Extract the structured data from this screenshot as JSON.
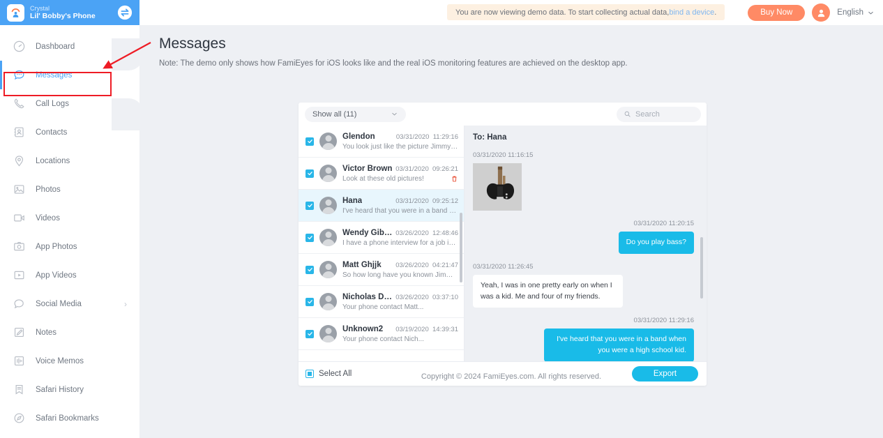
{
  "sidebar": {
    "account": {
      "name": "Crystal",
      "device": "Lil' Bobby's Phone"
    },
    "logo_icon": "famieyes-logo-icon",
    "swap_icon": "swap-device-icon",
    "items": [
      {
        "label": "Dashboard",
        "icon": "dashboard-icon",
        "active": false,
        "chevron": false
      },
      {
        "label": "Messages",
        "icon": "messages-icon",
        "active": true,
        "chevron": false
      },
      {
        "label": "Call Logs",
        "icon": "phone-icon",
        "active": false,
        "chevron": false
      },
      {
        "label": "Contacts",
        "icon": "contacts-icon",
        "active": false,
        "chevron": false
      },
      {
        "label": "Locations",
        "icon": "location-pin-icon",
        "active": false,
        "chevron": false
      },
      {
        "label": "Photos",
        "icon": "photo-icon",
        "active": false,
        "chevron": false
      },
      {
        "label": "Videos",
        "icon": "video-icon",
        "active": false,
        "chevron": false
      },
      {
        "label": "App Photos",
        "icon": "camera-icon",
        "active": false,
        "chevron": false
      },
      {
        "label": "App Videos",
        "icon": "play-box-icon",
        "active": false,
        "chevron": false
      },
      {
        "label": "Social Media",
        "icon": "chat-bubble-icon",
        "active": false,
        "chevron": true
      },
      {
        "label": "Notes",
        "icon": "note-pencil-icon",
        "active": false,
        "chevron": false
      },
      {
        "label": "Voice Memos",
        "icon": "waveform-icon",
        "active": false,
        "chevron": false
      },
      {
        "label": "Safari History",
        "icon": "bookmark-list-icon",
        "active": false,
        "chevron": false
      },
      {
        "label": "Safari Bookmarks",
        "icon": "safari-compass-icon",
        "active": false,
        "chevron": false
      }
    ]
  },
  "topbar": {
    "banner_text": "You are now viewing demo data. To start collecting actual data, ",
    "banner_link": "bind a device",
    "banner_tail": ".",
    "buy_now": "Buy Now",
    "avatar_icon": "user-avatar-icon",
    "language": "English",
    "language_chevron_icon": "chevron-down-icon"
  },
  "main": {
    "title": "Messages",
    "note": "Note: The demo only shows how FamiEyes for iOS looks like and the real iOS monitoring features are achieved on the desktop app.",
    "copyright": "Copyright © 2024 FamiEyes.com. All rights reserved."
  },
  "toolbar": {
    "filter_label": "Show all (11)",
    "filter_chevron_icon": "chevron-down-icon",
    "search_placeholder": "Search",
    "search_value": "",
    "search_icon": "search-icon"
  },
  "conversations": [
    {
      "name": "Glendon",
      "date": "03/31/2020",
      "time": "11:29:16",
      "preview": "You look just like the picture Jimmy sh...",
      "checked": true,
      "selected": false,
      "delete": false
    },
    {
      "name": "Victor Brown",
      "date": "03/31/2020",
      "time": "09:26:21",
      "preview": "Look at these old pictures!",
      "checked": true,
      "selected": false,
      "delete": true
    },
    {
      "name": "Hana",
      "date": "03/31/2020",
      "time": "09:25:12",
      "preview": "I've heard that you were in a band whe...",
      "checked": true,
      "selected": true,
      "delete": false
    },
    {
      "name": "Wendy Gibson",
      "date": "03/26/2020",
      "time": "12:48:46",
      "preview": "I have a phone interview for a job in an...",
      "checked": true,
      "selected": false,
      "delete": false
    },
    {
      "name": "Matt Ghjjk",
      "date": "03/26/2020",
      "time": "04:21:47",
      "preview": "So how long have you known Jimmy...",
      "checked": true,
      "selected": false,
      "delete": false
    },
    {
      "name": "Nicholas Dell...",
      "date": "03/26/2020",
      "time": "03:37:10",
      "preview": "Your phone contact Matt...",
      "checked": true,
      "selected": false,
      "delete": false
    },
    {
      "name": "Unknown2",
      "date": "03/19/2020",
      "time": "14:39:31",
      "preview": "Your phone contact Nich...",
      "checked": true,
      "selected": false,
      "delete": false
    }
  ],
  "thread": {
    "title": "To: Hana",
    "messages": [
      {
        "timestamp": "03/31/2020  11:16:15",
        "side": "in",
        "type": "image",
        "text": "",
        "image_icon": "bass-guitar-photo"
      },
      {
        "timestamp": "03/31/2020  11:20:15",
        "side": "out",
        "type": "text",
        "text": "Do you play bass?"
      },
      {
        "timestamp": "03/31/2020  11:26:45",
        "side": "in",
        "type": "text",
        "text": "Yeah, I was in one pretty early on when I was a kid. Me and four of my friends."
      },
      {
        "timestamp": "03/31/2020  11:29:16",
        "side": "out",
        "type": "text",
        "text": "I've heard that you were in a band when you were a high school kid."
      }
    ]
  },
  "footer": {
    "select_all": "Select All",
    "export": "Export"
  },
  "colors": {
    "brand_blue": "#4ba3f5",
    "accent_cyan": "#19bbe8",
    "buy_orange": "#ff8a65",
    "banner_bg": "#fdf0e1",
    "page_bg": "#eef0f4",
    "annotation_red": "#ee1c25"
  }
}
